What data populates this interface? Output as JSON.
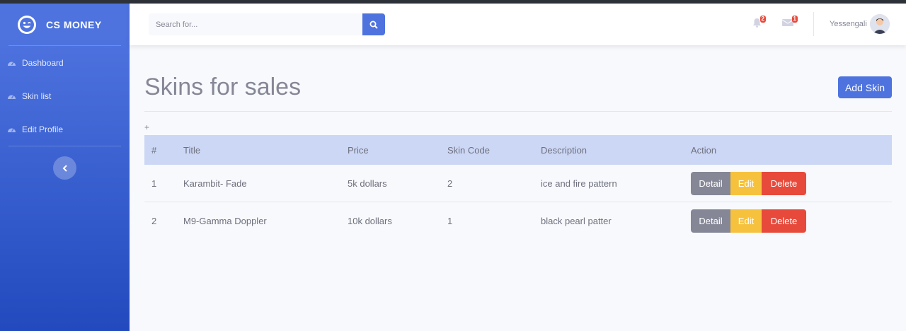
{
  "brand": {
    "name": "CS MONEY"
  },
  "sidebar": {
    "items": [
      {
        "label": "Dashboard",
        "icon": "tachometer-icon"
      },
      {
        "label": "Skin list",
        "icon": "tachometer-icon"
      },
      {
        "label": "Edit Profile",
        "icon": "tachometer-icon"
      }
    ],
    "toggle_icon": "chevron-left-icon"
  },
  "topbar": {
    "search_placeholder": "Search for...",
    "alerts_count": "2",
    "messages_count": "1",
    "username": "Yessengali"
  },
  "main": {
    "title": "Skins for sales",
    "add_button": "Add Skin",
    "plus": "+",
    "table": {
      "headers": [
        "#",
        "Title",
        "Price",
        "Skin Code",
        "Description",
        "Action"
      ],
      "rows": [
        {
          "num": "1",
          "title": "Karambit- Fade",
          "price": "5k dollars",
          "code": "2",
          "description": "ice and fire pattern"
        },
        {
          "num": "2",
          "title": "M9-Gamma Doppler",
          "price": "10k dollars",
          "code": "1",
          "description": "black pearl patter"
        }
      ],
      "actions": {
        "detail": "Detail",
        "edit": "Edit",
        "delete": "Delete"
      }
    }
  },
  "colors": {
    "primary": "#4e73df",
    "warning": "#f6c23e",
    "danger": "#e74a3b",
    "secondary": "#858796"
  }
}
